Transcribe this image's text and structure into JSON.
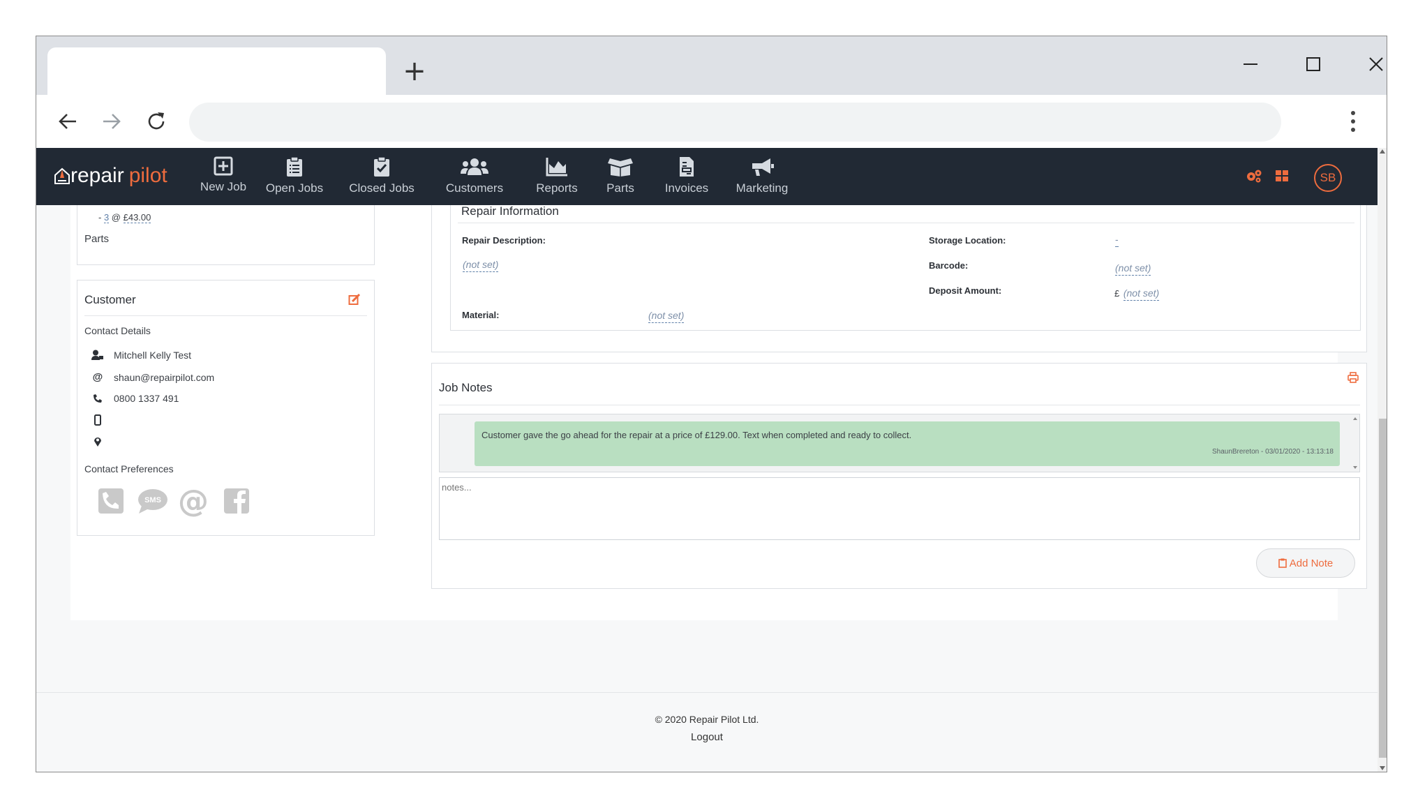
{
  "browser": {
    "new_tab_symbol": "+",
    "address": ""
  },
  "nav": {
    "logo_part1": "repair",
    "logo_part2": "pilot",
    "items": [
      {
        "label": "New Job",
        "icon": "plus-square-icon"
      },
      {
        "label": "Open Jobs",
        "icon": "clipboard-list-icon"
      },
      {
        "label": "Closed Jobs",
        "icon": "clipboard-check-icon"
      },
      {
        "label": "Customers",
        "icon": "users-icon"
      },
      {
        "label": "Reports",
        "icon": "area-chart-icon"
      },
      {
        "label": "Parts",
        "icon": "box-open-icon"
      },
      {
        "label": "Invoices",
        "icon": "file-invoice-icon"
      },
      {
        "label": "Marketing",
        "icon": "bullhorn-icon"
      }
    ],
    "avatar_initials": "SB",
    "accent": "#ee6c3e",
    "bar_color": "#212934"
  },
  "left_top": {
    "partial_line": "- 3  @ £43.00",
    "qty": "3",
    "price": "£43.00",
    "parts_label": "Parts"
  },
  "customer": {
    "title": "Customer",
    "contact_details_label": "Contact Details",
    "name": "Mitchell Kelly Test",
    "email": "shaun@repairpilot.com",
    "phone": "0800 1337 491",
    "mobile": "",
    "address": "",
    "preferences_label": "Contact Preferences"
  },
  "repair_info": {
    "title": "Repair Information",
    "repair_description_label": "Repair Description:",
    "repair_description_value": "(not set)",
    "material_label": "Material:",
    "material_value": "(not set)",
    "storage_location_label": "Storage Location:",
    "storage_location_value": "-",
    "barcode_label": "Barcode:",
    "barcode_value": "(not set)",
    "deposit_amount_label": "Deposit Amount:",
    "deposit_currency": "£",
    "deposit_amount_value": "(not set)"
  },
  "job_notes": {
    "title": "Job Notes",
    "note_text": "Customer gave the go ahead for the repair at a price of £129.00. Text when completed and ready to collect.",
    "note_meta": "ShaunBrereton - 03/01/2020 - 13:13:18",
    "notes_placeholder": "notes...",
    "add_note_label": "Add Note",
    "bubble_color": "#b9dfc1"
  },
  "footer": {
    "copyright": "© 2020 Repair Pilot Ltd.",
    "logout": "Logout"
  }
}
